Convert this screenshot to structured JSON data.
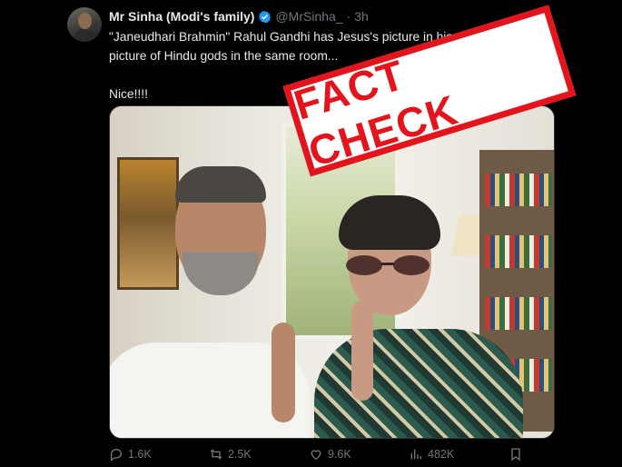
{
  "post": {
    "display_name": "Mr Sinha (Modi's family)",
    "handle": "@MrSinha_",
    "separator": "·",
    "time": "3h",
    "more": "···",
    "text": "\"Janeudhari Brahmin\" Rahul Gandhi has Jesus's picture in his room.... No\npicture of Hindu gods in the same room...\n\nNice!!!!",
    "stamp": "FACT CHECK"
  },
  "actions": {
    "replies": "1.6K",
    "reposts": "2.5K",
    "likes": "9.6K",
    "views": "482K"
  },
  "colors": {
    "background": "#000000",
    "text": "#e7e9ea",
    "muted": "#71767b",
    "verified": "#1d9bf0",
    "stamp": "#e3141b"
  },
  "icons": [
    "verified-badge-icon",
    "more-icon",
    "reply-icon",
    "repost-icon",
    "like-icon",
    "views-icon",
    "bookmark-icon"
  ]
}
